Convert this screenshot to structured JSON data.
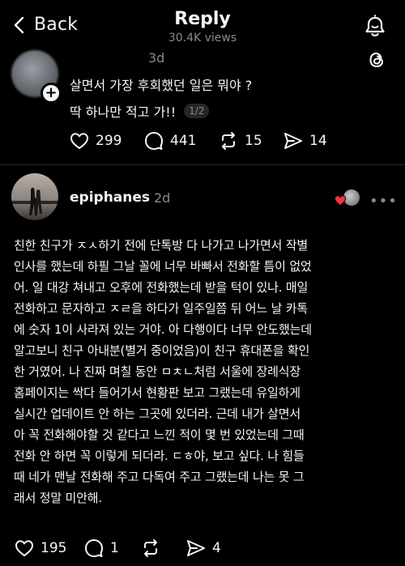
{
  "header": {
    "back_label": "Back",
    "title": "Reply",
    "views": "30.4K views",
    "back_icon": "chevron-left-icon",
    "bell_icon": "activity-bell-icon"
  },
  "parent_post": {
    "time": "3d",
    "line1": "살면서 가장 후회했던 일은 뭐야 ?",
    "line2": "딱 하나만 적고 가!!",
    "page_indicator": "1/2",
    "likes": "299",
    "comments": "441",
    "reposts": "15",
    "shares": "14"
  },
  "reply": {
    "username": "epiphanes",
    "time": "2d",
    "lines": [
      "친한 친구가 ㅈㅅ하기 전에 단톡방 다 나가고 나가면서 작별",
      "인사를 했는데 하필 그날 꼴에 너무 바빠서 전화할 틈이 없었",
      "어. 일 대강 쳐내고 오후에 전화했는데 받을 턱이 있나. 매일",
      "전화하고 문자하고 ㅈㄹ을 하다가 일주일쯤 뒤 어느 날 카톡",
      "에 숫자 1이 사라져 있는 거야. 아 다행이다 너무 안도했는데",
      "알고보니 친구 아내분(별거 중이었음)이 친구 휴대폰을 확인",
      "한 거였어. 나 진짜 며칠 동안 ㅁㅊㄴ처럼 서울에 장례식장",
      "홈페이지는 싹다 들어가서 현황판 보고 그랬는데 유일하게",
      "실시간 업데이트 안 하는 그곳에 있더라. 근데 내가 살면서",
      "아 꼭 전화해야할 것 같다고 느낀 적이 몇 번 있었는데 그때",
      "전화 안 하면 꼭 이렇게 되더라. ㄷㅎ야, 보고 싶다. 나 힘들",
      "때 네가 맨날 전화해 주고 다독여 주고 그랬는데 나는 못 그",
      "래서 정말 미안해."
    ],
    "likes": "195",
    "comments": "1",
    "reposts": "",
    "shares": "4"
  },
  "colors": {
    "background": "#000000",
    "text": "#f3f5f7",
    "secondary": "#8a8a8a",
    "heart_red": "#ff3040"
  }
}
